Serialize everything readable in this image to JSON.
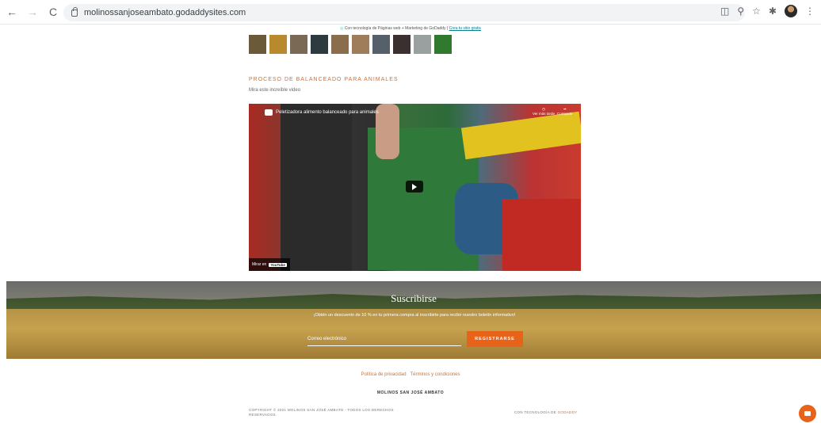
{
  "browser": {
    "url": "molinossanjoseambato.godaddysites.com",
    "back_glyph": "←",
    "forward_glyph": "→",
    "reload_glyph": "C",
    "right_icons": [
      "◫",
      "⚲",
      "☆",
      "✱"
    ]
  },
  "gd_banner": {
    "text": "Con tecnología de Páginas web + Marketing de GoDaddy",
    "sep": "|",
    "link": "Crea tu sitio gratis"
  },
  "thumbs": [
    "#6b5a3a",
    "#b88a2d",
    "#7a6a55",
    "#2d3b3f",
    "#8a6d4d",
    "#a07d5a",
    "#55606a",
    "#3b3030",
    "#9aa0a0",
    "#2f7a2f"
  ],
  "section": {
    "title": "PROCESO DE BALANCEADO PARA ANIMALES",
    "subtitle": "Mira este increíble video"
  },
  "video": {
    "title": "Peletizadora alimento balanceado para animales",
    "watch_later": "Ver más tarde",
    "share": "Compartir",
    "watch_on": "Mirar en",
    "yt": "YouTube"
  },
  "subscribe": {
    "title": "Suscribirse",
    "text": "¡Obtén un descuento de 10 % en tu primera compra al inscribirte para recibir nuestro boletín informativo!",
    "email_placeholder": "Correo electrónico",
    "button": "REGISTRARSE"
  },
  "footer": {
    "privacy": "Política de privacidad",
    "terms": "Términos y condiciones",
    "brand": "MOLINOS SAN JOSÉ AMBATO",
    "copyright": "COPYRIGHT © 2021 MOLINOS SAN JOSÉ AMBATO - TODOS LOS DERECHOS RESERVADOS.",
    "powered_prefix": "CON TECNOLOGÍA DE",
    "powered_brand": "GODADDY"
  }
}
